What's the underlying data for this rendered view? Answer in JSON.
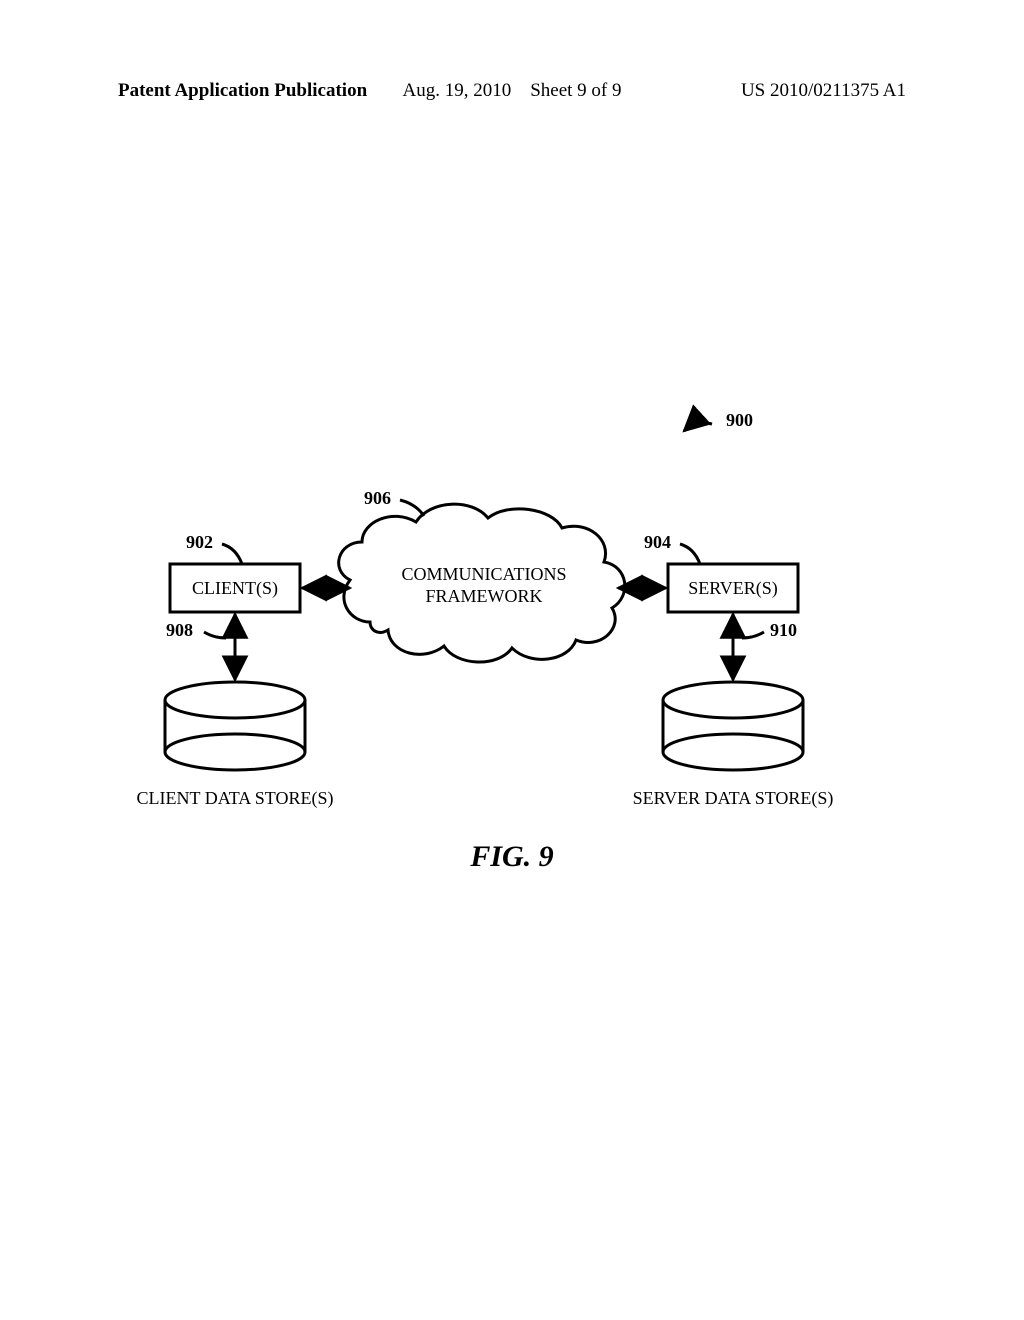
{
  "header": {
    "left": "Patent Application Publication",
    "date": "Aug. 19, 2010",
    "sheet": "Sheet 9 of 9",
    "pubno": "US 2010/0211375 A1"
  },
  "refs": {
    "system": "900",
    "client": "902",
    "server": "904",
    "cloud": "906",
    "clientStore": "908",
    "serverStore": "910"
  },
  "labels": {
    "client": "CLIENT(S)",
    "server": "SERVER(S)",
    "cloud1": "COMMUNICATIONS",
    "cloud2": "FRAMEWORK",
    "clientStore": "CLIENT DATA STORE(S)",
    "serverStore": "SERVER DATA STORE(S)"
  },
  "figure": "FIG. 9"
}
